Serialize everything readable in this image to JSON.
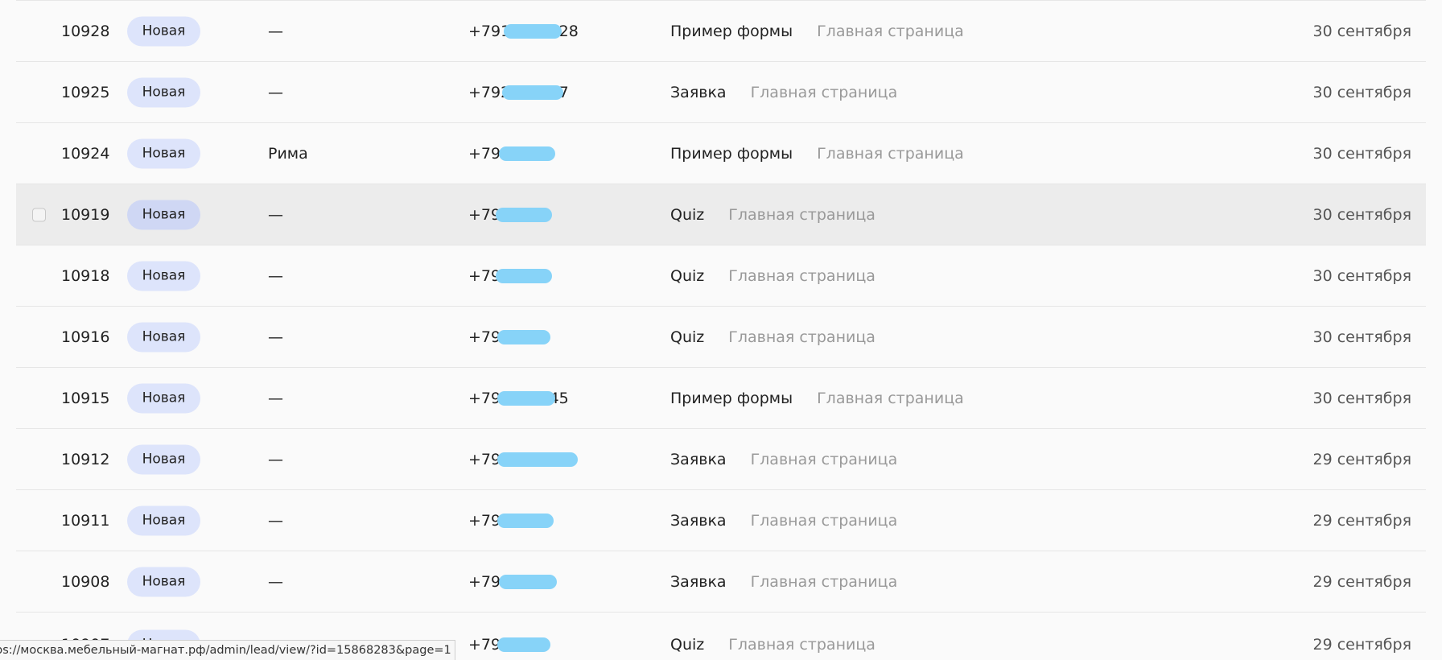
{
  "leads": [
    {
      "id": "10928",
      "status": "Новая",
      "name": "—",
      "phone": "+7916942928",
      "form": "Пример формы",
      "page": "Главная страница",
      "date": "30 сентября"
    },
    {
      "id": "10925",
      "status": "Новая",
      "name": "—",
      "phone": "+792571807",
      "form": "Заявка",
      "page": "Главная страница",
      "date": "30 сентября"
    },
    {
      "id": "10924",
      "status": "Новая",
      "name": "Рима",
      "phone": "+792",
      "form": "Пример формы",
      "page": "Главная страница",
      "date": "30 сентября"
    },
    {
      "id": "10919",
      "status": "Новая",
      "name": "—",
      "phone": "+7926",
      "form": "Quiz",
      "page": "Главная страница",
      "date": "30 сентября",
      "hovered": true
    },
    {
      "id": "10918",
      "status": "Новая",
      "name": "—",
      "phone": "+791",
      "form": "Quiz",
      "page": "Главная страница",
      "date": "30 сентября"
    },
    {
      "id": "10916",
      "status": "Новая",
      "name": "—",
      "phone": "+792",
      "form": "Quiz",
      "page": "Главная страница",
      "date": "30 сентября"
    },
    {
      "id": "10915",
      "status": "Новая",
      "name": "—",
      "phone": "+792681845",
      "form": "Пример формы",
      "page": "Главная страница",
      "date": "30 сентября"
    },
    {
      "id": "10912",
      "status": "Новая",
      "name": "—",
      "phone": "+792960790",
      "form": "Заявка",
      "page": "Главная страница",
      "date": "29 сентября"
    },
    {
      "id": "10911",
      "status": "Новая",
      "name": "—",
      "phone": "+792",
      "form": "Заявка",
      "page": "Главная страница",
      "date": "29 сентября"
    },
    {
      "id": "10908",
      "status": "Новая",
      "name": "—",
      "phone": "+792614",
      "form": "Заявка",
      "page": "Главная страница",
      "date": "29 сентября"
    },
    {
      "id": "10907",
      "status": "Новая",
      "name": "—",
      "phone": "+790977",
      "form": "Quiz",
      "page": "Главная страница",
      "date": "29 сентября"
    }
  ],
  "status_bar": {
    "url": "ps://москва.мебельный-магнат.рф/admin/lead/view/?id=15868283&page=1"
  },
  "colors": {
    "badge_bg": "#dde4fb",
    "phone_mask": "#87d3f8",
    "hover_row": "#ececec"
  }
}
